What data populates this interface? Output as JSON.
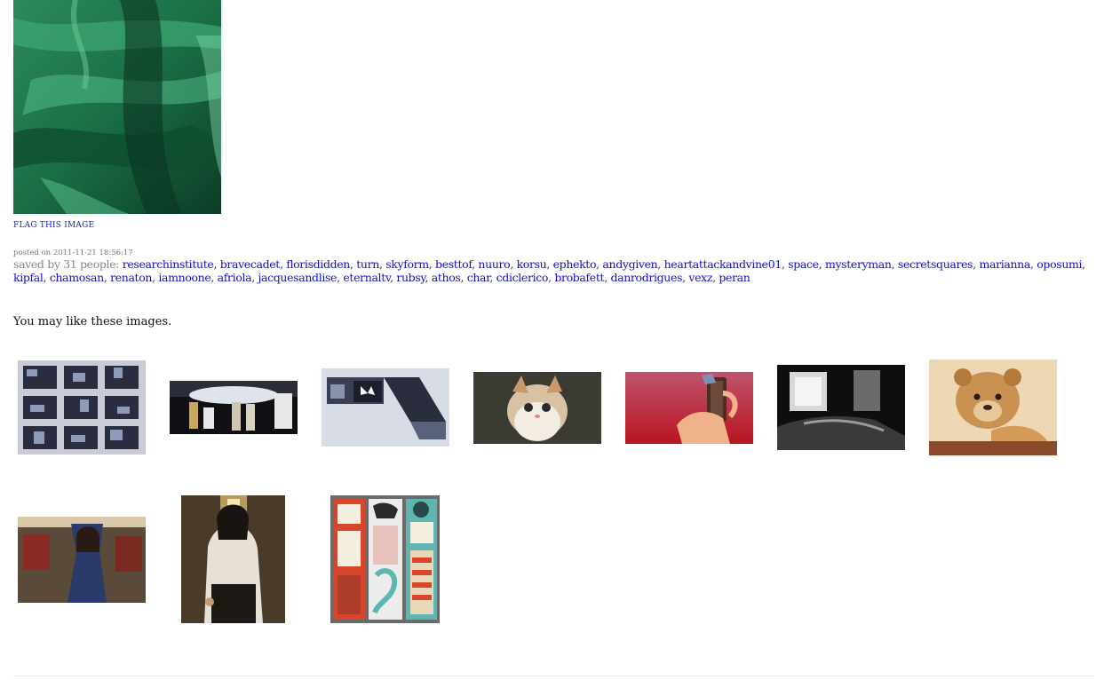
{
  "main_image": {
    "alt": "",
    "colors": {
      "base": "#1e7a50",
      "light": "#5ec591",
      "dark": "#062a1b"
    }
  },
  "flag": {
    "label": "FLAG THIS IMAGE"
  },
  "post": {
    "posted_on_label": "posted on",
    "posted_on_value": "2011-11-21 18:56:17"
  },
  "saved": {
    "label": "saved by 31 people:",
    "users": [
      "researchinstitute",
      "bravecadet",
      "florisdidden",
      "turn",
      "skyform",
      "besttof",
      "nuuro",
      "korsu",
      "ephekto",
      "andygiven",
      "heartattackandvine01",
      "space",
      "mysteryman",
      "secretsquares",
      "marianna",
      "oposumi",
      "kipfal",
      "chamosan",
      "renaton",
      "iamnoone",
      "afriola",
      "jacquesandlise",
      "eternaltv",
      "rubsy",
      "athos",
      "char",
      "cdiclerico",
      "brobafett",
      "danrodrigues",
      "vexz",
      "peran"
    ]
  },
  "recommendations": {
    "heading": "You may like these images.",
    "thumbnails": [
      {
        "name": "thumb-batman-comic-grid"
      },
      {
        "name": "thumb-star-wars-droids"
      },
      {
        "name": "thumb-batman-panels"
      },
      {
        "name": "thumb-kitten"
      },
      {
        "name": "thumb-hands-holding-object"
      },
      {
        "name": "thumb-dark-window-room"
      },
      {
        "name": "thumb-lion-cub"
      },
      {
        "name": "thumb-woman-subway"
      },
      {
        "name": "thumb-woman-hallway"
      },
      {
        "name": "thumb-three-cheers-for-books"
      }
    ]
  },
  "colors": {
    "link": "#1010cc",
    "muted": "#888888"
  }
}
